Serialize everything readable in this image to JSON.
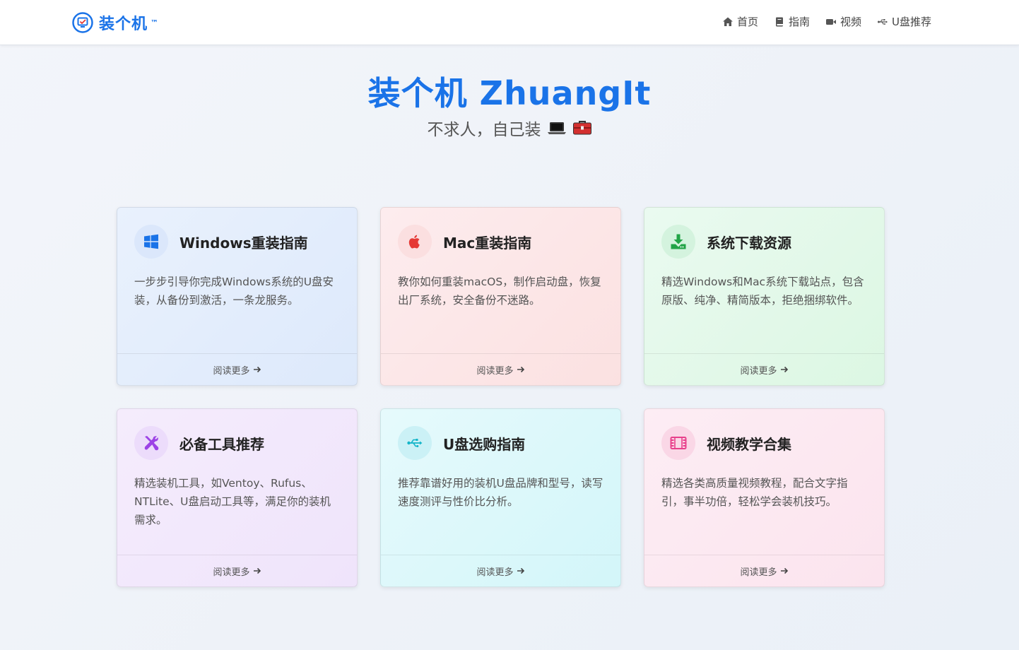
{
  "brand": {
    "name": "装个机",
    "tm": "™",
    "logo_icon": "monitor-check-icon"
  },
  "nav": [
    {
      "label": "首页",
      "icon": "home-icon"
    },
    {
      "label": "指南",
      "icon": "book-icon"
    },
    {
      "label": "视频",
      "icon": "video-camera-icon"
    },
    {
      "label": "U盘推荐",
      "icon": "usb-icon"
    }
  ],
  "hero": {
    "title": "装个机 ZhuangIt",
    "subtitle": "不求人，自己装",
    "subtitle_icons": [
      "laptop-emoji-icon",
      "toolbox-emoji-icon"
    ]
  },
  "cards": [
    {
      "title": "Windows重装指南",
      "desc": "一步步引导你完成Windows系统的U盘安装，从备份到激活，一条龙服务。",
      "link": "阅读更多",
      "icon": "windows-icon",
      "accent": "#1a73e8"
    },
    {
      "title": "Mac重装指南",
      "desc": "教你如何重装macOS，制作启动盘，恢复出厂系统，安全备份不迷路。",
      "link": "阅读更多",
      "icon": "apple-icon",
      "accent": "#e53935"
    },
    {
      "title": "系统下载资源",
      "desc": "精选Windows和Mac系统下载站点，包含原版、纯净、精简版本，拒绝捆绑软件。",
      "link": "阅读更多",
      "icon": "download-icon",
      "accent": "#22a447"
    },
    {
      "title": "必备工具推荐",
      "desc": "精选装机工具，如Ventoy、Rufus、NTLite、U盘启动工具等，满足你的装机需求。",
      "link": "阅读更多",
      "icon": "tools-icon",
      "accent": "#9c42e6"
    },
    {
      "title": "U盘选购指南",
      "desc": "推荐靠谱好用的装机U盘品牌和型号，读写速度测评与性价比分析。",
      "link": "阅读更多",
      "icon": "usb-icon",
      "accent": "#14b5c9"
    },
    {
      "title": "视频教学合集",
      "desc": "精选各类高质量视频教程，配合文字指引，事半功倍，轻松学会装机技巧。",
      "link": "阅读更多",
      "icon": "film-icon",
      "accent": "#e8418c"
    }
  ]
}
